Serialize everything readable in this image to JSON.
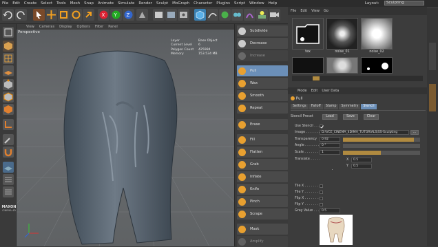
{
  "menubar": {
    "items": [
      "File",
      "Edit",
      "Create",
      "Select",
      "Tools",
      "Mesh",
      "Snap",
      "Animate",
      "Simulate",
      "Render",
      "Sculpt",
      "MoGraph",
      "Character",
      "Plugins",
      "Script",
      "Window",
      "Help"
    ],
    "layout_label": "Layout:",
    "layout_value": "Sculpting"
  },
  "viewport": {
    "menu": [
      "View",
      "Cameras",
      "Display",
      "Options",
      "Filter",
      "Panel"
    ],
    "label": "Perspective",
    "info": [
      {
        "k": "Layer",
        "v": "Base Object"
      },
      {
        "k": "Current Level",
        "v": "6"
      },
      {
        "k": "Polygon Count",
        "v": "425984"
      },
      {
        "k": "Memory",
        "v": "153.534 MB"
      }
    ]
  },
  "brushes": [
    "Subdivide",
    "Decrease",
    "Increase",
    "Pull",
    "Wax",
    "Smooth",
    "Repeat",
    "Erase",
    "Fill",
    "Flatten",
    "Grab",
    "Inflate",
    "Knife",
    "Pinch",
    "Scrape",
    "Mask",
    "Amplify"
  ],
  "content_browser": {
    "menu": [
      "File",
      "Edit",
      "View",
      "Go"
    ],
    "thumbs": [
      {
        "label": "tex"
      },
      {
        "label": "noise_01"
      },
      {
        "label": "noise_02"
      }
    ]
  },
  "attributes": {
    "menu": [
      "Mode",
      "Edit",
      "User Data"
    ],
    "title": "Pull",
    "tabs": [
      "Settings",
      "Falloff",
      "Stamp",
      "Symmetry",
      "Stencil"
    ],
    "active_tab": "Stencil",
    "section": "Stencil",
    "preset_label": "Stencil Preset",
    "load": "Load",
    "save": "Save",
    "clear": "Clear",
    "use_stencil": "Use Stencil . . . . .",
    "image_label": "Image . . . . . . .",
    "image_path": "D:\\VCE_CINEMA_4D\\MH_TUTORIALS\\SS-Sculpting",
    "browse": "...",
    "transparency_label": "Transparency",
    "transparency_value": "0.92",
    "transparency_fraction": 0.92,
    "angle_label": "Angle . . . . . . .",
    "angle_value": "0 °",
    "scale_label": "Scale . . . . . . .",
    "scale_value": "1",
    "translate_label": "Translate . . . . .",
    "tx_label": "X",
    "tx": "0.5",
    "ty_label": "Y",
    "ty": "0.5",
    "tile_x": "Tile X . . . . . . .",
    "tile_y": "Tile Y . . . . . . .",
    "flip_x": "Flip X . . . . . . .",
    "flip_y": "Flip Y . . . . . . .",
    "gray_label": "Gray Value . . . .",
    "gray_value": "0.5"
  },
  "logo": {
    "line1": "MAXON",
    "line2": "CINEMA 4D"
  },
  "colors": {
    "accent": "#6b8fb8",
    "slider": "#b08a40"
  }
}
